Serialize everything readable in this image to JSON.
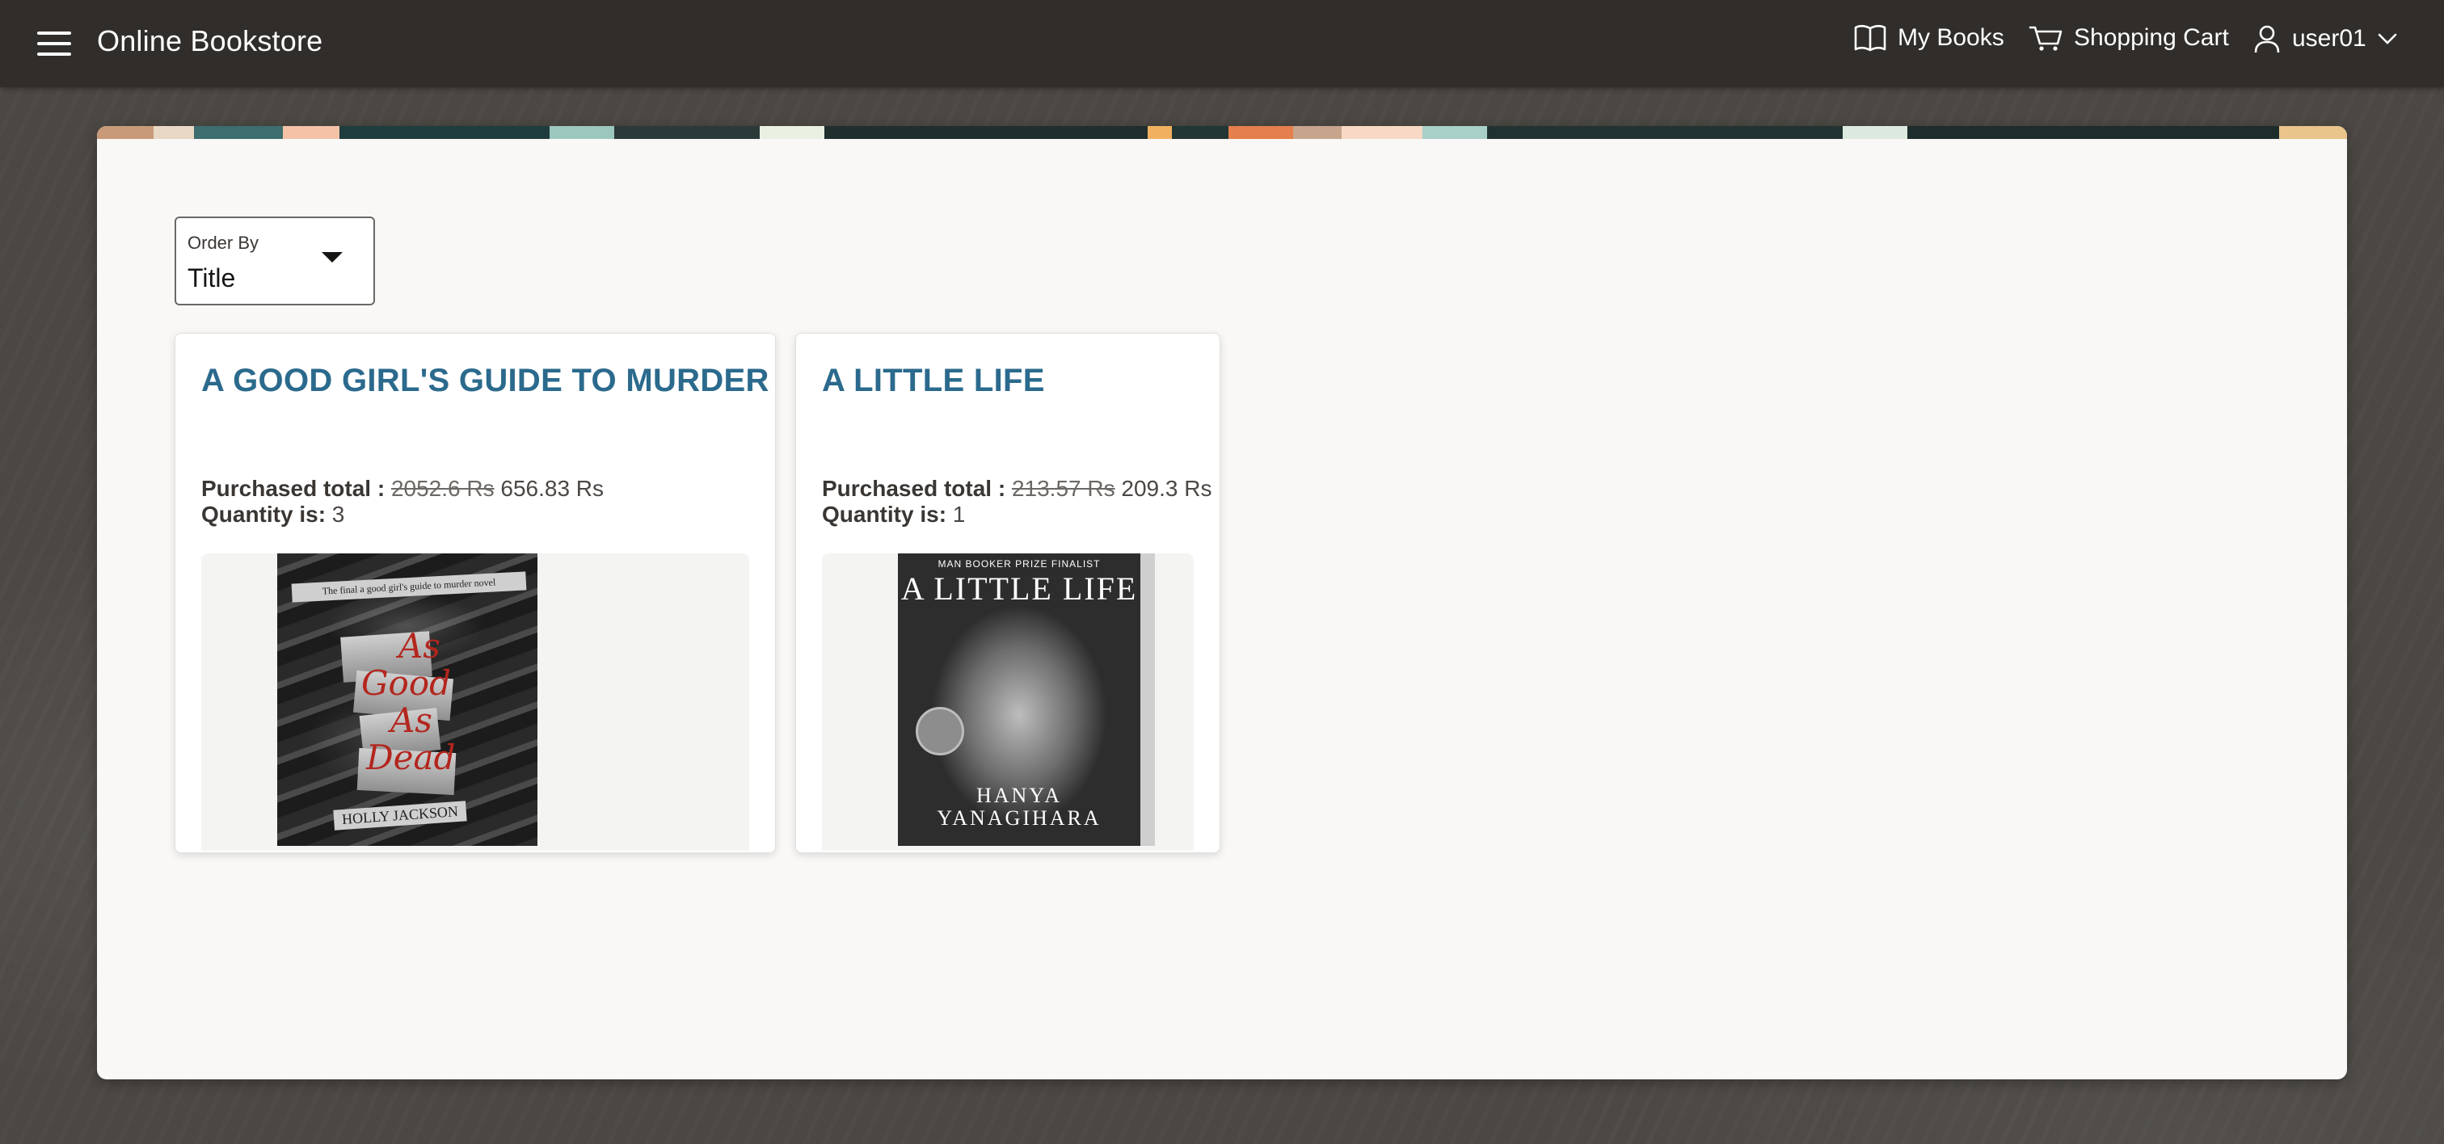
{
  "header": {
    "app_title": "Online Bookstore",
    "nav": {
      "my_books": "My Books",
      "shopping_cart": "Shopping Cart",
      "user": "user01"
    }
  },
  "filters": {
    "order_by_label": "Order By",
    "order_by_value": "Title"
  },
  "books": [
    {
      "title": "A GOOD GIRL'S GUIDE TO MURDER",
      "purchased_label": "Purchased total :",
      "original_price": "2052.6 Rs",
      "discounted_price": "656.83 Rs",
      "quantity_label": "Quantity is:",
      "quantity": "3",
      "cover": {
        "tagline": "The final a good girl's guide to murder novel",
        "words": [
          "As",
          "Good",
          "As",
          "Dead"
        ],
        "author": "HOLLY JACKSON"
      }
    },
    {
      "title": "A LITTLE LIFE",
      "purchased_label": "Purchased total :",
      "original_price": "213.57 Rs",
      "discounted_price": "209.3 Rs",
      "quantity_label": "Quantity is:",
      "quantity": "1",
      "cover": {
        "tagline": "MAN BOOKER PRIZE FINALIST",
        "title": "A LITTLE LIFE",
        "author": "HANYA YANAGIHARA"
      }
    }
  ],
  "colors": {
    "header_bg": "#312d2a",
    "page_bg": "#4b4743",
    "panel_bg": "#f9f8f6",
    "title_accent": "#2b6a8d"
  }
}
